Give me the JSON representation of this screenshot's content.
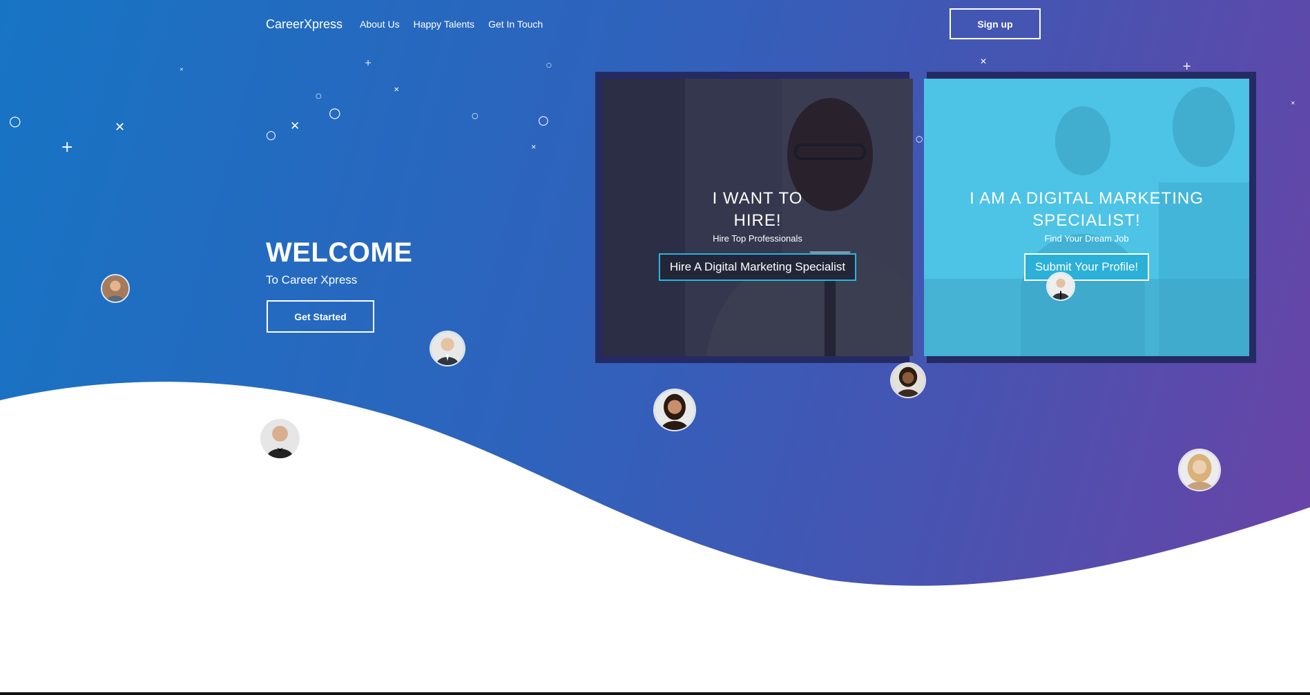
{
  "nav": {
    "brand": "CareerXpress",
    "links": [
      "About Us",
      "Happy Talents",
      "Get In Touch"
    ],
    "signup_label": "Sign up"
  },
  "hero": {
    "title": "WELCOME",
    "subtitle": "To Career Xpress",
    "cta_label": "Get Started"
  },
  "cards": [
    {
      "title_line1": "I WANT TO",
      "title_line2": "HIRE!",
      "subtitle": "Hire Top Professionals",
      "button_label": "Hire A Digital Marketing Specialist"
    },
    {
      "title_line1": "I AM A DIGITAL MARKETING",
      "title_line2": "SPECIALIST!",
      "subtitle": "Find Your Dream Job",
      "button_label": "Submit Your Profile!"
    }
  ],
  "colors": {
    "gradient_start": "#1774c4",
    "gradient_end": "#6a43a6",
    "card_frame": "#262a63",
    "card_accent": "#29b6e0",
    "card2_overlay": "#4dc3e6"
  },
  "icons": {
    "decorations": [
      "circle-icon",
      "plus-icon",
      "cross-icon"
    ],
    "avatars": [
      "avatar-icon"
    ]
  }
}
